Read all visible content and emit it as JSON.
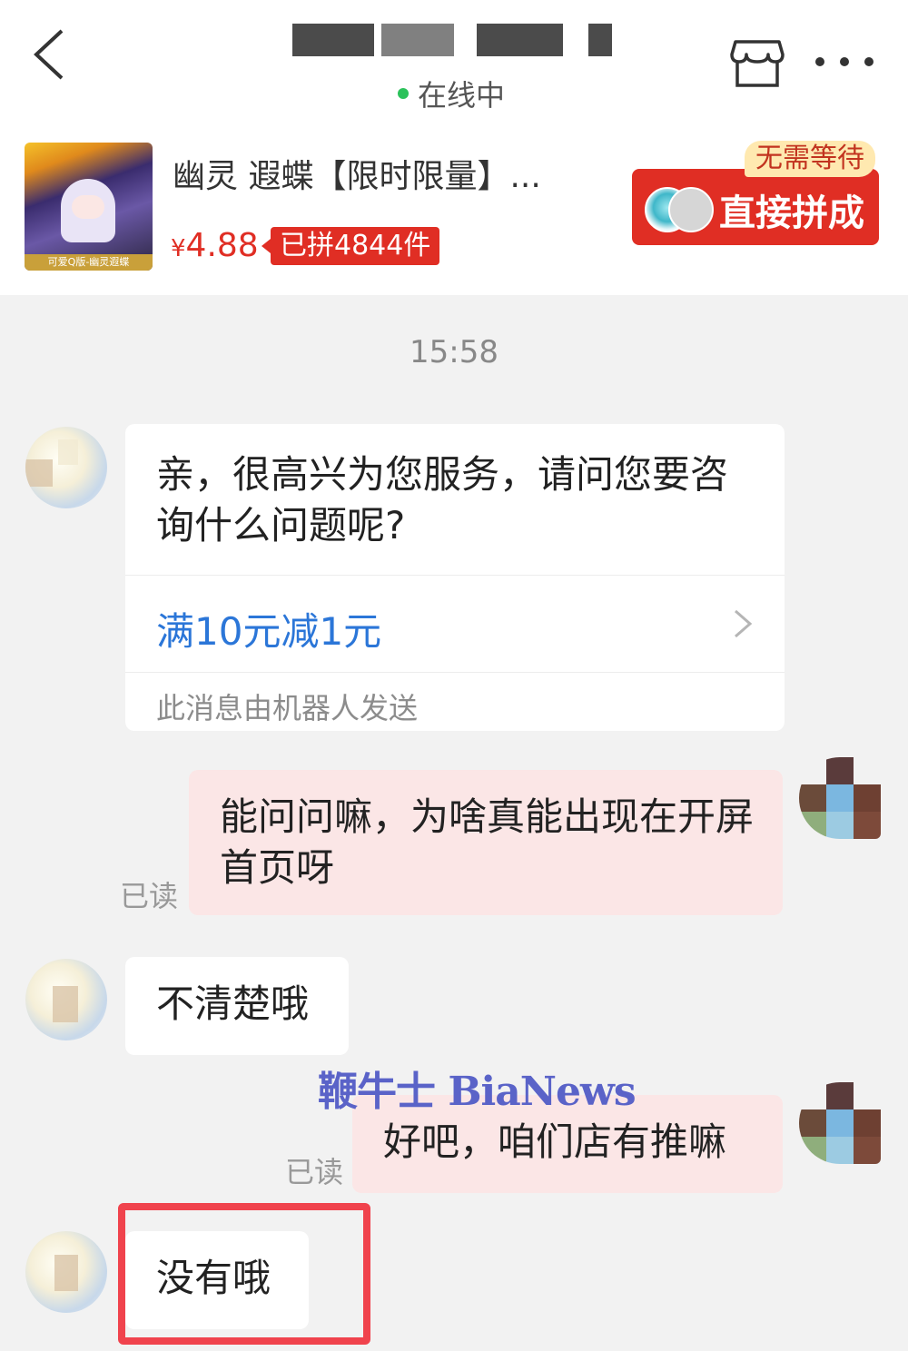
{
  "header": {
    "status": "在线中",
    "icons": {
      "back": "back-chevron-icon",
      "store": "store-icon",
      "more": "more-dots-icon"
    }
  },
  "product": {
    "name": "幽灵 遐蝶【限时限量】...",
    "thumb_caption": "可爱Q版-幽灵遐蝶",
    "currency": "¥",
    "price": "4.88",
    "sold": "已拼4844件",
    "badge": "无需等待",
    "buy_label": "直接拼成"
  },
  "chat": {
    "time": "15:58",
    "messages": [
      {
        "side": "left",
        "text": "亲，很高兴为您服务，请问您要咨询什么问题呢?",
        "link": "满10元减1元",
        "note": "此消息由机器人发送"
      },
      {
        "side": "right",
        "text": "能问问嘛，为啥真能出现在开屏首页呀",
        "read": "已读"
      },
      {
        "side": "left",
        "text": "不清楚哦"
      },
      {
        "side": "right",
        "text": "好吧，咱们店有推嘛",
        "read": "已读"
      },
      {
        "side": "left",
        "text": "没有哦"
      }
    ]
  },
  "watermark": "鞭牛士 BiaNews",
  "colors": {
    "accent_red": "#e02e24",
    "link_blue": "#2b76d8",
    "online_green": "#2cc25b",
    "highlight": "#f0434d"
  }
}
